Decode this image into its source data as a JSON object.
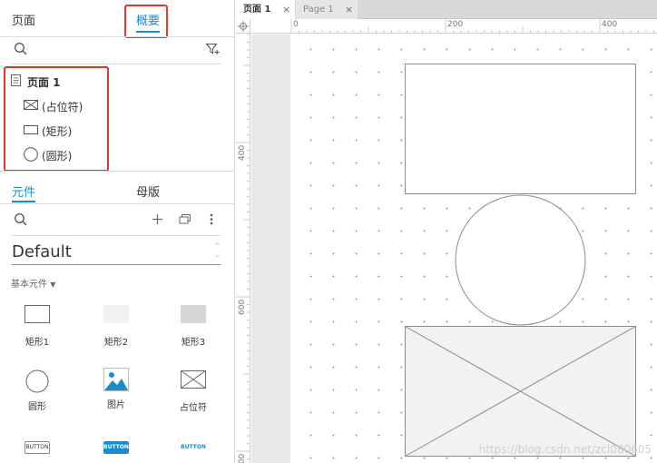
{
  "left_panel": {
    "tabs": {
      "pages": "页面",
      "outline": "概要"
    },
    "outline_tree": {
      "root": "页面 1",
      "items": [
        "(占位符)",
        "(矩形)",
        "(圆形)"
      ]
    },
    "library_tabs": {
      "widgets": "元件",
      "masters": "母版"
    },
    "library": {
      "selected": "Default",
      "category": "基本元件",
      "widgets": [
        {
          "label": "矩形1"
        },
        {
          "label": "矩形2"
        },
        {
          "label": "矩形3"
        },
        {
          "label": "圆形"
        },
        {
          "label": "图片"
        },
        {
          "label": "占位符"
        },
        {
          "label": "BUTTON"
        },
        {
          "label": "BUTTON"
        },
        {
          "label": "BUTTON"
        }
      ]
    }
  },
  "editor": {
    "tabs": [
      {
        "label": "页面 1",
        "active": true
      },
      {
        "label": "Page 1",
        "active": false
      }
    ],
    "ruler_h": [
      "0",
      "200",
      "400"
    ],
    "ruler_v": [
      "400",
      "600",
      "800"
    ],
    "watermark": "https://blog.csdn.net/zcl080605"
  },
  "colors": {
    "accent": "#1a8ccc",
    "highlight": "#e8332a"
  }
}
